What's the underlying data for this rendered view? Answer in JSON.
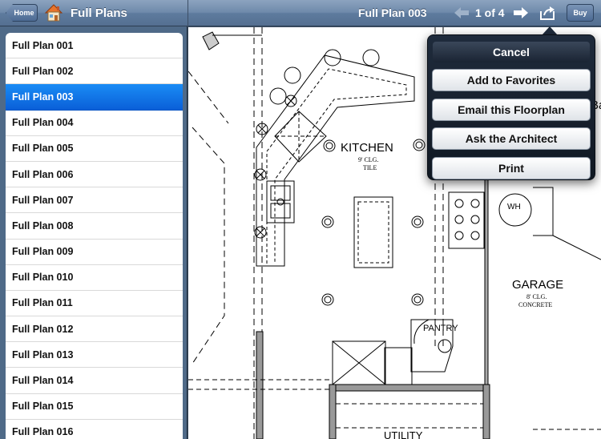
{
  "sidebar": {
    "home_label": "Home",
    "title": "Full Plans",
    "selected_index": 2,
    "items": [
      {
        "label": "Full Plan 001"
      },
      {
        "label": "Full Plan 002"
      },
      {
        "label": "Full Plan 003"
      },
      {
        "label": "Full Plan 004"
      },
      {
        "label": "Full Plan 005"
      },
      {
        "label": "Full Plan 006"
      },
      {
        "label": "Full Plan 007"
      },
      {
        "label": "Full Plan 008"
      },
      {
        "label": "Full Plan 009"
      },
      {
        "label": "Full Plan 010"
      },
      {
        "label": "Full Plan 011"
      },
      {
        "label": "Full Plan 012"
      },
      {
        "label": "Full Plan 013"
      },
      {
        "label": "Full Plan 014"
      },
      {
        "label": "Full Plan 015"
      },
      {
        "label": "Full Plan 016"
      }
    ]
  },
  "toolbar": {
    "plan_title": "Full Plan 003",
    "page_indicator": "1 of 4",
    "buy_label": "Buy",
    "icons": {
      "prev": "left-arrow-icon",
      "next": "right-arrow-icon",
      "share": "share-icon"
    }
  },
  "floorplan": {
    "kitchen": {
      "name": "KITCHEN",
      "ceiling": "9' CLG.",
      "floor": "TILE"
    },
    "garage": {
      "name": "GARAGE",
      "ceiling": "8' CLG.",
      "floor": "CONCRETE"
    },
    "pantry": "PANTRY",
    "water_heater": "WH",
    "utility": "UTILITY",
    "bath_partial": "Ba"
  },
  "popover": {
    "cancel_label": "Cancel",
    "actions": [
      {
        "label": "Add to Favorites"
      },
      {
        "label": "Email this Floorplan"
      },
      {
        "label": "Ask the Architect"
      },
      {
        "label": "Print"
      }
    ]
  },
  "colors": {
    "selection": "#0a6ae0",
    "toolbar": "#6f8aab",
    "popover": "#1a2433"
  }
}
